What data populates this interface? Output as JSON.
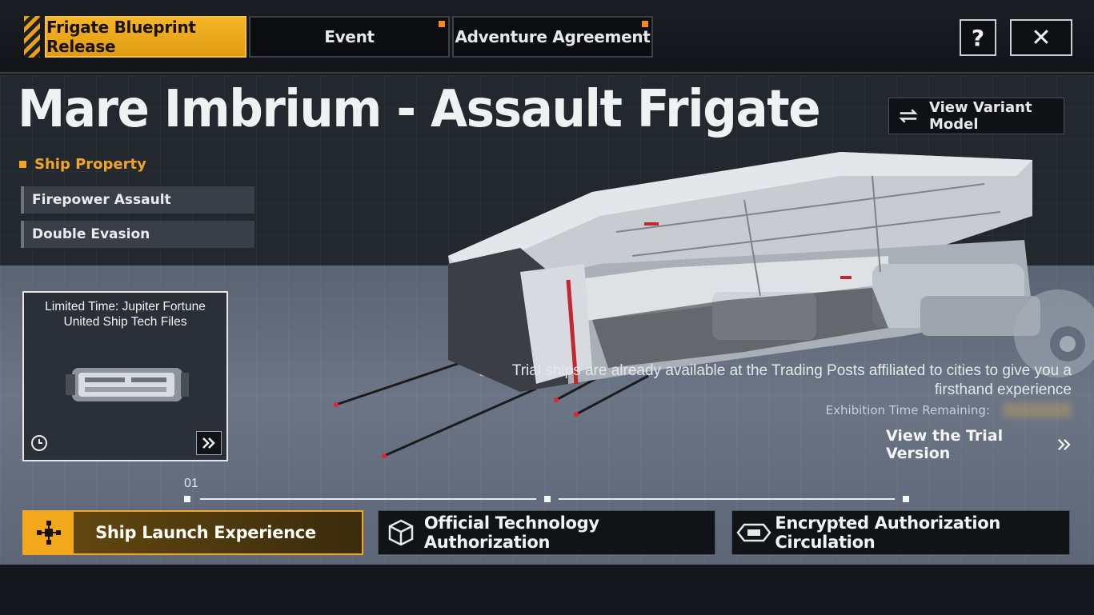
{
  "tabs": [
    {
      "label": "Frigate Blueprint Release",
      "active": true
    },
    {
      "label": "Event",
      "active": false
    },
    {
      "label": "Adventure Agreement",
      "active": false
    }
  ],
  "header_icons": {
    "help": "?",
    "close": "✕"
  },
  "ship": {
    "title": "Mare Imbrium - Assault Frigate",
    "variant_button": "View Variant Model",
    "property_label": "Ship Property",
    "properties": [
      "Firepower Assault",
      "Double Evasion"
    ]
  },
  "promo": {
    "line1": "Limited Time: Jupiter Fortune",
    "line2": "United Ship Tech Files"
  },
  "trial": {
    "message": "Trial ships are already available at the Trading Posts affiliated to cities to give you a firsthand experience",
    "exhibition_label": "Exhibition Time Remaining:",
    "button": "View the Trial Version"
  },
  "timeline": {
    "step": "01"
  },
  "bottom_buttons": [
    {
      "label": "Ship Launch Experience",
      "active": true
    },
    {
      "label": "Official Technology Authorization",
      "active": false
    },
    {
      "label": "Encrypted Authorization Circulation",
      "active": false
    }
  ],
  "colors": {
    "accent": "#f0a624",
    "panel": "#23272e",
    "tab_active": "#f6b526"
  }
}
